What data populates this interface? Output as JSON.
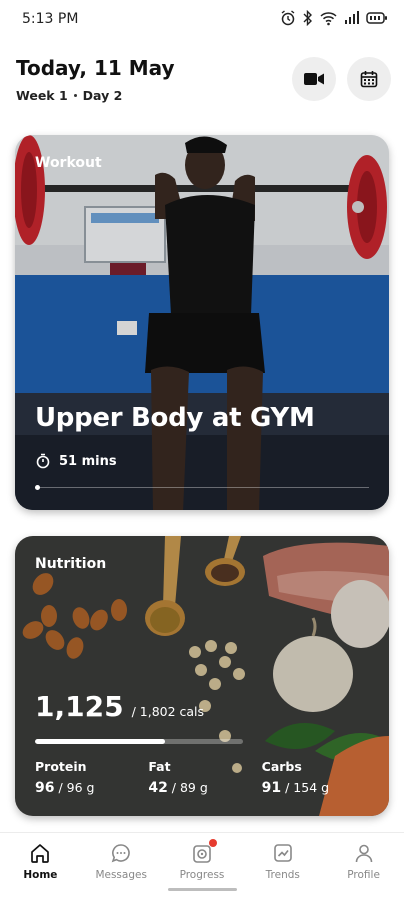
{
  "status_bar": {
    "time": "5:13 PM",
    "icons": [
      "alarm-icon",
      "bluetooth-icon",
      "wifi-icon",
      "signal-icon",
      "battery-icon"
    ]
  },
  "header": {
    "title": "Today, 11 May",
    "week": "Week 1",
    "day": "Day 2",
    "buttons": [
      "video-icon",
      "calendar-icon"
    ]
  },
  "workout": {
    "label": "Workout",
    "title": "Upper Body at GYM",
    "duration": "51 mins"
  },
  "nutrition": {
    "label": "Nutrition",
    "calories": "1,125",
    "calories_total": "/ 1,802 cals",
    "calories_progress": 0.624,
    "macros": [
      {
        "label": "Protein",
        "value": "96",
        "total": "/ 96 g"
      },
      {
        "label": "Fat",
        "value": "42",
        "total": "/ 89 g"
      },
      {
        "label": "Carbs",
        "value": "91",
        "total": "/ 154 g"
      }
    ]
  },
  "nav": {
    "items": [
      {
        "label": "Home",
        "icon": "home-icon",
        "active": true
      },
      {
        "label": "Messages",
        "icon": "messages-icon"
      },
      {
        "label": "Progress",
        "icon": "progress-icon",
        "badge": true
      },
      {
        "label": "Trends",
        "icon": "trends-icon"
      },
      {
        "label": "Profile",
        "icon": "profile-icon"
      }
    ]
  },
  "colors": {
    "badge": "#e63b2e",
    "gym_wall": "#1f5fae",
    "plate": "#c9262e"
  }
}
